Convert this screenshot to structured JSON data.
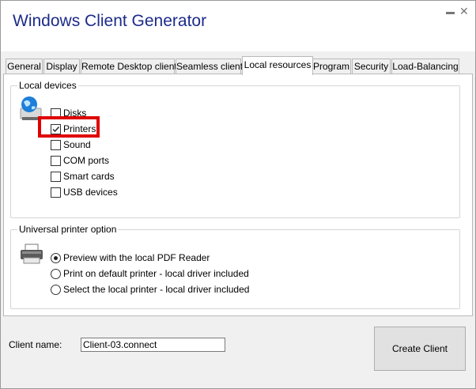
{
  "window": {
    "title": "Windows Client Generator"
  },
  "tabs": [
    {
      "label": "General"
    },
    {
      "label": "Display"
    },
    {
      "label": "Remote Desktop client"
    },
    {
      "label": "Seamless client"
    },
    {
      "label": "Local resources",
      "active": true
    },
    {
      "label": "Program"
    },
    {
      "label": "Security"
    },
    {
      "label": "Load-Balancing"
    }
  ],
  "local_devices": {
    "title": "Local devices",
    "icon": "globe-computer-icon",
    "items": [
      {
        "label": "Disks",
        "checked": false
      },
      {
        "label": "Printers",
        "checked": true
      },
      {
        "label": "Sound",
        "checked": false
      },
      {
        "label": "COM ports",
        "checked": false
      },
      {
        "label": "Smart cards",
        "checked": false
      },
      {
        "label": "USB devices",
        "checked": false
      }
    ]
  },
  "printer_option": {
    "title": "Universal printer option",
    "icon": "printer-icon",
    "options": [
      {
        "label": "Preview with the local PDF Reader",
        "selected": true
      },
      {
        "label": "Print on default printer - local driver included",
        "selected": false
      },
      {
        "label": "Select the local printer - local driver included",
        "selected": false
      }
    ]
  },
  "client": {
    "label": "Client name:",
    "value": "Client-03.connect"
  },
  "create_button": {
    "label": "Create Client"
  },
  "highlight_color": "#e00000",
  "title_color": "#1c2b8a"
}
